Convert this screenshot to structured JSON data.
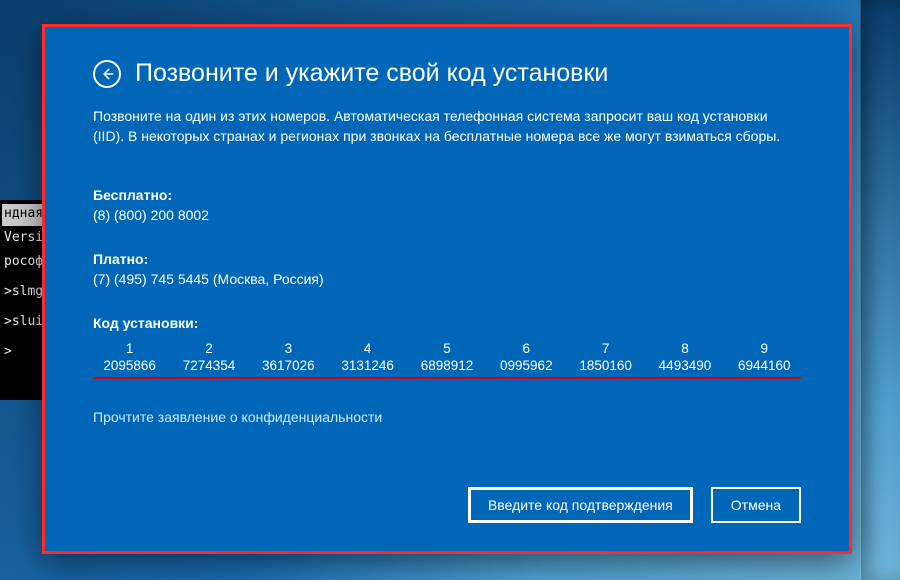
{
  "cmd": {
    "lines": [
      "ндная ст",
      "Versic",
      "рософт",
      ">slmgr",
      ">slui",
      ">"
    ]
  },
  "dialog": {
    "title": "Позвоните и укажите свой код установки",
    "description": "Позвоните на один из этих номеров. Автоматическая телефонная система запросит ваш код установки (IID). В некоторых странах и регионах при звонках на бесплатные номера все же могут взиматься сборы.",
    "free_label": "Бесплатно:",
    "free_number": "(8) (800) 200 8002",
    "paid_label": "Платно:",
    "paid_number": "(7) (495) 745 5445 (Москва, Россия)",
    "iid_label": "Код установки:",
    "iid_index": [
      "1",
      "2",
      "3",
      "4",
      "5",
      "6",
      "7",
      "8",
      "9"
    ],
    "iid_values": [
      "2095866",
      "7274354",
      "3617026",
      "3131246",
      "6898912",
      "0995962",
      "1850160",
      "4493490",
      "6944160"
    ],
    "privacy_link": "Прочтите заявление о конфиденциальности",
    "enter_code_btn": "Введите код подтверждения",
    "cancel_btn": "Отмена"
  }
}
